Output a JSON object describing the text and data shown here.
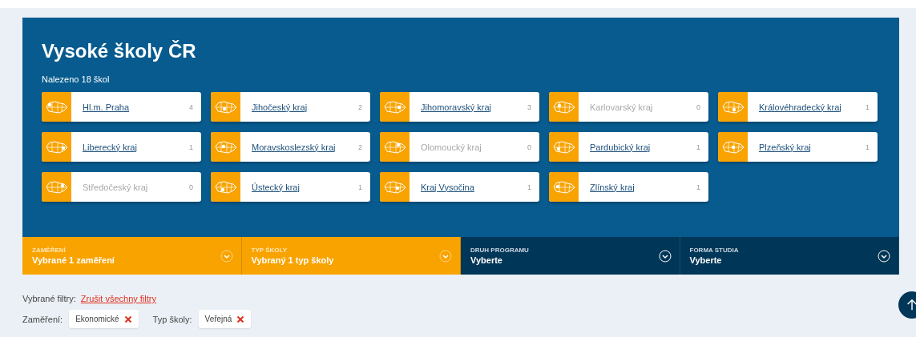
{
  "header": {
    "title": "Vysoké školy ČR",
    "found": "Nalezeno 18 škol"
  },
  "regions": [
    {
      "name": "Hl.m. Praha",
      "count": "4",
      "disabled": false
    },
    {
      "name": "Jihočeský kraj",
      "count": "2",
      "disabled": false
    },
    {
      "name": "Jihomoravský kraj",
      "count": "3",
      "disabled": false
    },
    {
      "name": "Karlovarský kraj",
      "count": "0",
      "disabled": true
    },
    {
      "name": "Královéhradecký kraj",
      "count": "1",
      "disabled": false
    },
    {
      "name": "Liberecký kraj",
      "count": "1",
      "disabled": false
    },
    {
      "name": "Moravskoslezský kraj",
      "count": "2",
      "disabled": false
    },
    {
      "name": "Olomoucký kraj",
      "count": "0",
      "disabled": true
    },
    {
      "name": "Pardubický kraj",
      "count": "1",
      "disabled": false
    },
    {
      "name": "Plzeňský kraj",
      "count": "1",
      "disabled": false
    },
    {
      "name": "Středočeský kraj",
      "count": "0",
      "disabled": true
    },
    {
      "name": "Ústecký kraj",
      "count": "1",
      "disabled": false
    },
    {
      "name": "Kraj Vysočina",
      "count": "1",
      "disabled": false
    },
    {
      "name": "Zlínský kraj",
      "count": "1",
      "disabled": false
    }
  ],
  "filters": [
    {
      "label": "ZAMĚŘENÍ",
      "value": "Vybrané 1 zaměření",
      "selected": true
    },
    {
      "label": "TYP ŠKOLY",
      "value": "Vybraný 1 typ školy",
      "selected": true
    },
    {
      "label": "DRUH PROGRAMU",
      "value": "Vyberte",
      "selected": false
    },
    {
      "label": "FORMA STUDIA",
      "value": "Vyberte",
      "selected": false
    }
  ],
  "selected_filters": {
    "label": "Vybrané filtry:",
    "clear_link": "Zrušit všechny filtry",
    "groups": [
      {
        "label": "Zaměření:",
        "chips": [
          "Ekonomické"
        ]
      },
      {
        "label": "Typ školy:",
        "chips": [
          "Veřejná"
        ]
      }
    ]
  }
}
